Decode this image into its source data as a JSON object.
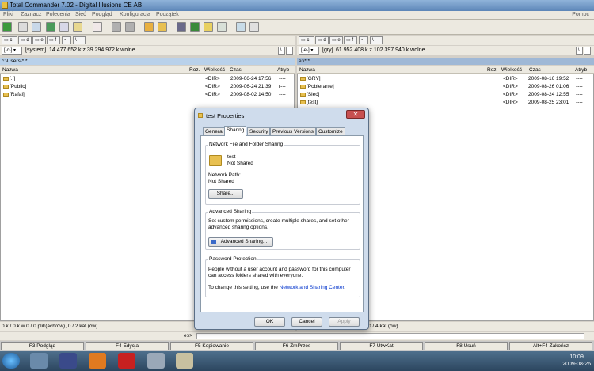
{
  "app": {
    "title": "Total Commander 7.02 - Digital Illusions CE AB"
  },
  "menu": {
    "items": [
      "Pliki",
      "Zaznacz",
      "Polecenia",
      "Sieć",
      "Podgląd",
      "Konfiguracja",
      "Początek"
    ],
    "right": "Pomoc"
  },
  "toolbar": {
    "icons": [
      "refresh-icon",
      "view-icon",
      "tree-icon",
      "thumbnails-icon",
      "view2-icon",
      "view3-icon",
      "star-icon",
      "back-icon",
      "forward-icon",
      "pack-icon",
      "unpack-icon",
      "find-icon",
      "ftp-icon",
      "sync-icon",
      "notepad-icon",
      "search-icon",
      "network-icon"
    ]
  },
  "left": {
    "drives": [
      "c",
      "d",
      "e",
      "f"
    ],
    "drive_select": "[-c-]",
    "volume": "[system]",
    "free": "14 477 652 k z 39 294 972 k wolne",
    "path": "c:\\Users\\*.*",
    "columns": {
      "name": "Nazwa",
      "ext": "Roz.",
      "size": "Wielkość",
      "date": "Czas",
      "attr": "Atryb"
    },
    "rows": [
      {
        "name": "[..]",
        "size": "<DIR>",
        "date": "2009-06-24 17:56",
        "attr": "----"
      },
      {
        "name": "[Public]",
        "size": "<DIR>",
        "date": "2009-06-24 21:39",
        "attr": "r---"
      },
      {
        "name": "[Rafal]",
        "size": "<DIR>",
        "date": "2009-08-02 14:50",
        "attr": "----"
      }
    ],
    "status": "0 k / 0 k w 0 / 0 plik(ach/ów), 0 / 2 kat.(ów)"
  },
  "right": {
    "drives": [
      "c",
      "d",
      "e",
      "f"
    ],
    "drive_select": "[-e-]",
    "volume": "[gry]",
    "free": "61 952 408 k z 102 397 940 k wolne",
    "path": "e:\\*.*",
    "columns": {
      "name": "Nazwa",
      "ext": "Roz.",
      "size": "Wielkość",
      "date": "Czas",
      "attr": "Atryb"
    },
    "rows": [
      {
        "name": "[GRY]",
        "size": "<DIR>",
        "date": "2009-08-16 19:52",
        "attr": "----"
      },
      {
        "name": "[Pobieranie]",
        "size": "<DIR>",
        "date": "2009-08-26 01:06",
        "attr": "----"
      },
      {
        "name": "[Sieć]",
        "size": "<DIR>",
        "date": "2009-08-24 12:55",
        "attr": "----"
      },
      {
        "name": "[test]",
        "size": "<DIR>",
        "date": "2009-08-25 23:01",
        "attr": "----"
      }
    ],
    "status": "0 / 4 kat.(ów)"
  },
  "cmdline": {
    "prompt": "e:\\>"
  },
  "fkeys": [
    "F3 Podgląd",
    "F4 Edycja",
    "F5 Kopiowanie",
    "F6 ZmPrzes",
    "F7 UtwKat",
    "F8 Usuń",
    "Alt+F4 Zakończ"
  ],
  "dialog": {
    "title": "test Properties",
    "close": "✕",
    "tabs": [
      "General",
      "Sharing",
      "Security",
      "Previous Versions",
      "Customize"
    ],
    "active_tab": "Sharing",
    "nfs": {
      "heading": "Network File and Folder Sharing",
      "folder_name": "test",
      "folder_state": "Not Shared",
      "path_label": "Network Path:",
      "path_value": "Not Shared",
      "share_button": "Share..."
    },
    "advanced": {
      "heading": "Advanced Sharing",
      "desc": "Set custom permissions, create multiple shares, and set other advanced sharing options.",
      "button": "Advanced Sharing..."
    },
    "password": {
      "heading": "Password Protection",
      "desc": "People without a user account and password for this computer can access folders shared with everyone.",
      "change_prefix": "To change this setting, use the ",
      "link": "Network and Sharing Center",
      "change_suffix": "."
    },
    "buttons": {
      "ok": "OK",
      "cancel": "Cancel",
      "apply": "Apply"
    }
  },
  "taskbar": {
    "time": "10:09",
    "date": "2009-08-26"
  }
}
